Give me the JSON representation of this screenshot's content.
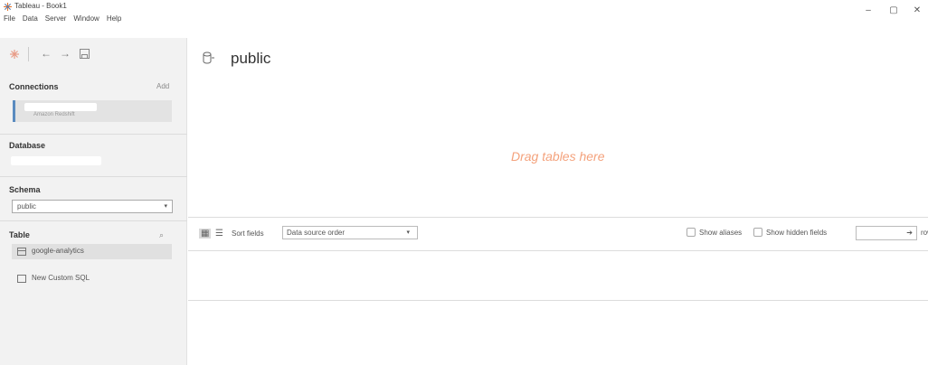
{
  "window": {
    "title": "Tableau - Book1",
    "controls": {
      "minimize": "–",
      "maximize": "▢",
      "close": "✕"
    }
  },
  "menu": [
    "File",
    "Data",
    "Server",
    "Window",
    "Help"
  ],
  "left": {
    "connections_title": "Connections",
    "add_label": "Add",
    "connection_type": "Amazon Redshift",
    "database_title": "Database",
    "schema_title": "Schema",
    "schema_value": "public",
    "table_title": "Table",
    "table_items": [
      "google-analytics"
    ],
    "new_custom_sql": "New Custom SQL"
  },
  "main": {
    "datasource_name": "public",
    "drag_hint": "Drag tables here"
  },
  "grid_toolbar": {
    "sort_label": "Sort fields",
    "sort_value": "Data source order",
    "show_aliases": "Show aliases",
    "show_hidden": "Show hidden fields",
    "rows_label": "row"
  },
  "colors": {
    "accent": "#5a8bbf",
    "drag_hint": "#f4a27c",
    "pane_bg": "#f2f2f2"
  }
}
